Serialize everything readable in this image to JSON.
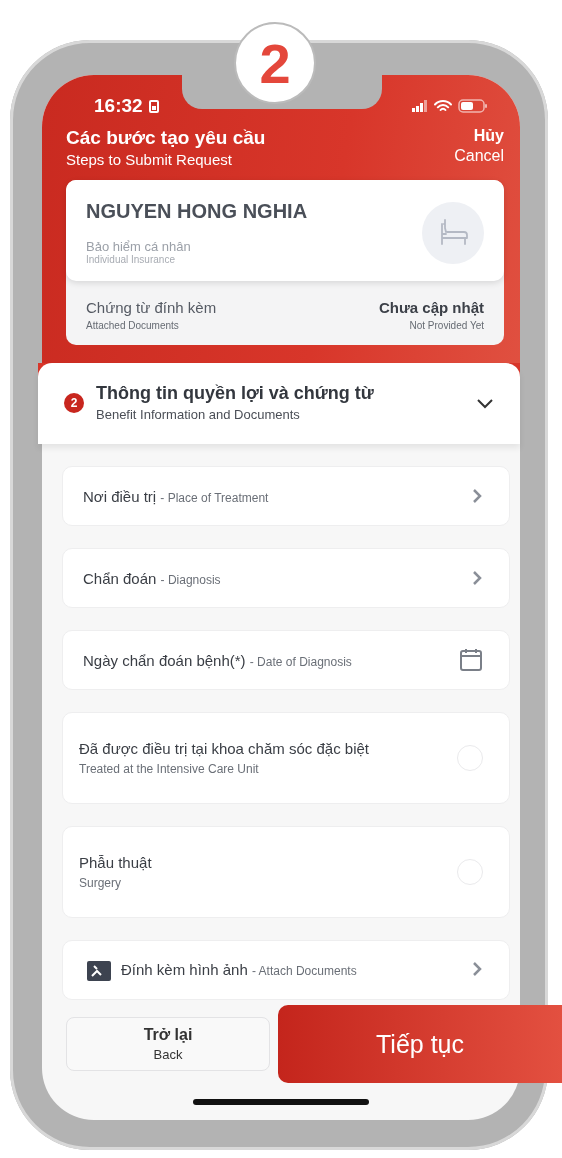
{
  "step_badge": "2",
  "status_bar": {
    "time": "16:32"
  },
  "header": {
    "title": "Các bước tạo yêu cầu",
    "subtitle": "Steps to Submit Request",
    "cancel": "Hủy",
    "cancel_en": "Cancel"
  },
  "profile": {
    "name": "NGUYEN HONG NGHIA",
    "plan": "Bảo hiểm cá nhân",
    "plan_en": "Individual Insurance",
    "docs_label": "Chứng từ đính kèm",
    "docs_label_en": "Attached Documents",
    "docs_status": "Chưa cập nhật",
    "docs_status_en": "Not Provided Yet"
  },
  "section": {
    "number": "2",
    "title": "Thông tin quyền lợi và chứng từ",
    "subtitle": "Benefit Information and Documents",
    "expanded": true
  },
  "fields": [
    {
      "kind": "select",
      "label": "Nơi điều trị",
      "hint": "- Place of Treatment"
    },
    {
      "kind": "select",
      "label": "Chẩn đoán",
      "hint": "- Diagnosis"
    },
    {
      "kind": "date",
      "label": "Ngày chẩn đoán bệnh(*)",
      "hint": "- Date of Diagnosis"
    },
    {
      "kind": "toggle",
      "label": "Đã được điều trị tại khoa chăm sóc đặc biệt",
      "hint": "Treated at the Intensive Care Unit",
      "checked": false
    },
    {
      "kind": "toggle",
      "label": "Phẫu thuật",
      "hint": "Surgery",
      "checked": false
    },
    {
      "kind": "attach",
      "label": "Đính kèm hình ảnh",
      "hint": "- Attach Documents"
    }
  ],
  "footer": {
    "back": "Trở lại",
    "back_en": "Back",
    "next": "Tiếp tục"
  }
}
